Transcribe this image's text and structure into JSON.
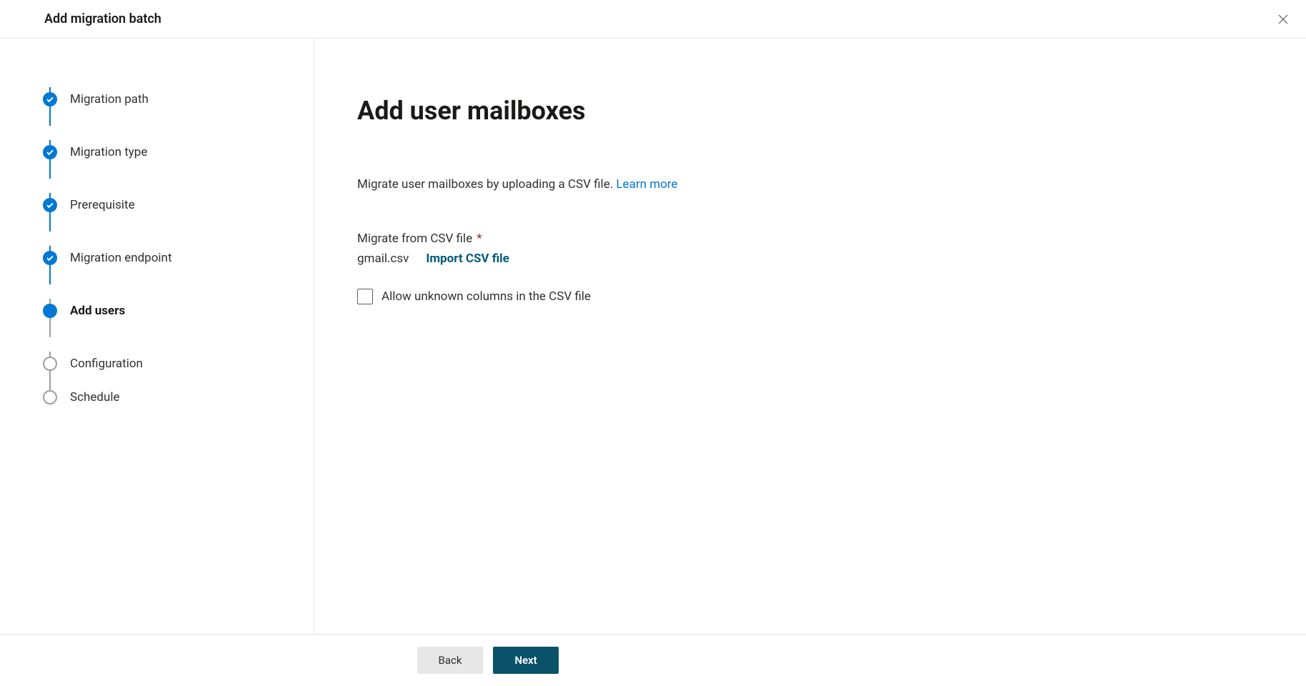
{
  "header": {
    "title": "Add migration batch"
  },
  "steps": [
    {
      "label": "Migration path",
      "state": "completed"
    },
    {
      "label": "Migration type",
      "state": "completed"
    },
    {
      "label": "Prerequisite",
      "state": "completed"
    },
    {
      "label": "Migration endpoint",
      "state": "completed"
    },
    {
      "label": "Add users",
      "state": "current"
    },
    {
      "label": "Configuration",
      "state": "pending"
    },
    {
      "label": "Schedule",
      "state": "pending"
    }
  ],
  "main": {
    "title": "Add user mailboxes",
    "description_text": "Migrate user mailboxes by uploading a CSV file. ",
    "learn_more": "Learn more",
    "field_label": "Migrate from CSV file",
    "file_name": "gmail.csv",
    "import_label": "Import CSV file",
    "checkbox_label": "Allow unknown columns in the CSV file"
  },
  "footer": {
    "back": "Back",
    "next": "Next"
  }
}
